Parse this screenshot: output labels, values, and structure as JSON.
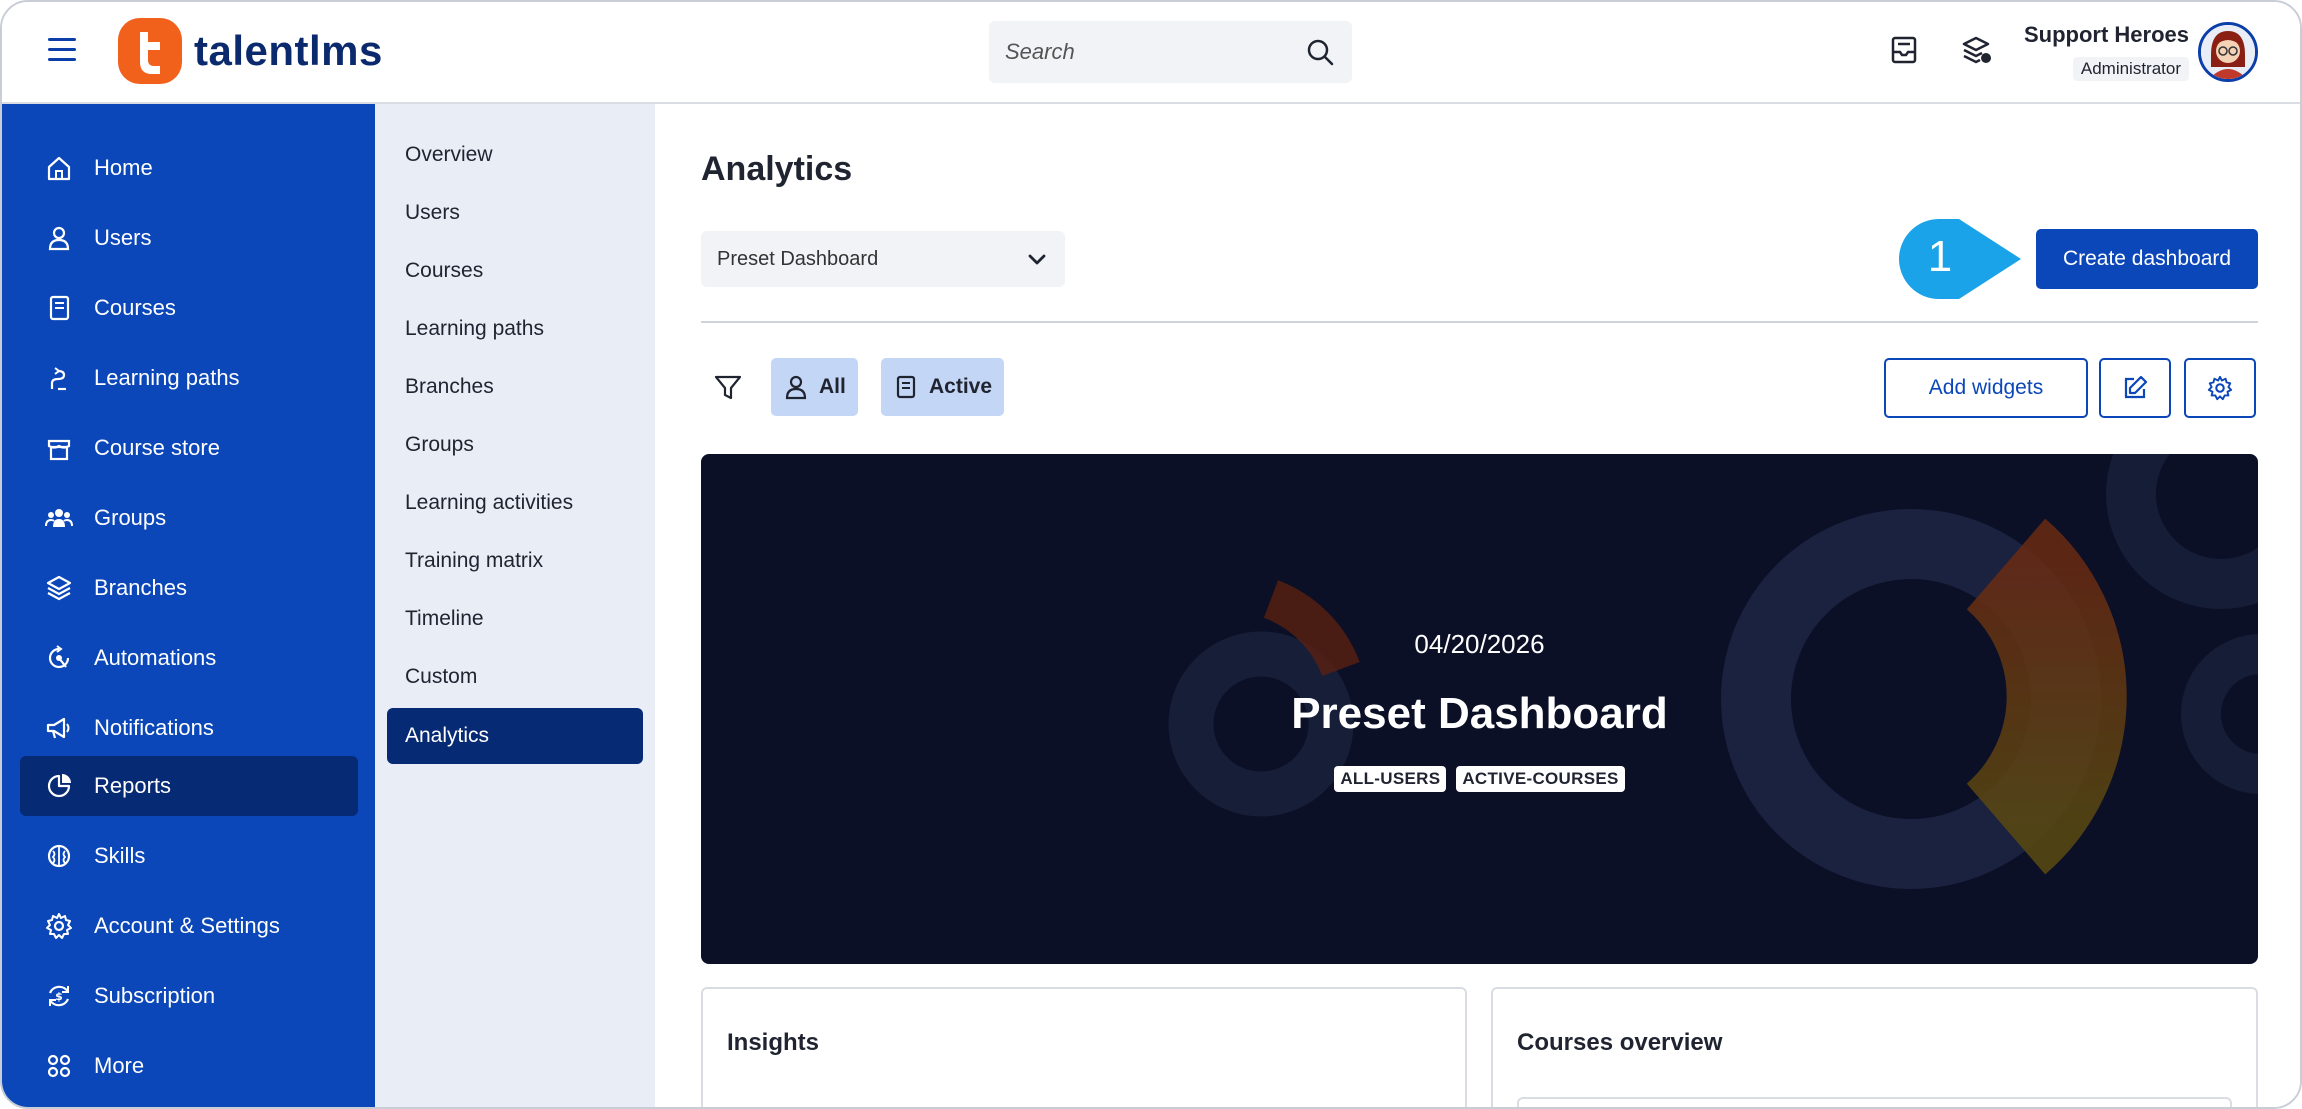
{
  "brand": {
    "name": "talentlms",
    "logo_color": "#f2611c",
    "text_color": "#0b2a6e"
  },
  "topbar": {
    "search_placeholder": "Search",
    "icons": [
      "inbox-icon",
      "messages-icon"
    ],
    "user": {
      "name": "Support Heroes",
      "role": "Administrator"
    }
  },
  "sidebar": {
    "color": "#0b47b8",
    "active_color": "#072a75",
    "items": [
      {
        "label": "Home",
        "icon": "home-icon"
      },
      {
        "label": "Users",
        "icon": "user-icon"
      },
      {
        "label": "Courses",
        "icon": "book-icon"
      },
      {
        "label": "Learning paths",
        "icon": "path-icon"
      },
      {
        "label": "Course store",
        "icon": "store-icon"
      },
      {
        "label": "Groups",
        "icon": "groups-icon"
      },
      {
        "label": "Branches",
        "icon": "layers-icon"
      },
      {
        "label": "Automations",
        "icon": "automation-icon"
      },
      {
        "label": "Notifications",
        "icon": "megaphone-icon"
      },
      {
        "label": "Reports",
        "icon": "pie-chart-icon",
        "active": true
      },
      {
        "label": "Skills",
        "icon": "brain-icon"
      },
      {
        "label": "Account & Settings",
        "icon": "gear-icon"
      },
      {
        "label": "Subscription",
        "icon": "subscription-icon"
      },
      {
        "label": "More",
        "icon": "grid-icon"
      }
    ]
  },
  "subnav": {
    "items": [
      {
        "label": "Overview"
      },
      {
        "label": "Users"
      },
      {
        "label": "Courses"
      },
      {
        "label": "Learning paths"
      },
      {
        "label": "Branches"
      },
      {
        "label": "Groups"
      },
      {
        "label": "Learning activities"
      },
      {
        "label": "Training matrix"
      },
      {
        "label": "Timeline"
      },
      {
        "label": "Custom"
      },
      {
        "label": "Analytics",
        "active": true
      }
    ]
  },
  "main": {
    "title": "Analytics",
    "dashboard_select": {
      "selected": "Preset Dashboard"
    },
    "callout_number": "1",
    "callout_color": "#1aa3e8",
    "create_button": "Create dashboard",
    "filters": {
      "users_chip": "All",
      "courses_chip": "Active"
    },
    "add_widgets_button": "Add widgets",
    "banner": {
      "date": "04/20/2026",
      "title": "Preset Dashboard",
      "tags": [
        "ALL-USERS",
        "ACTIVE-COURSES"
      ]
    },
    "cards": [
      {
        "title": "Insights"
      },
      {
        "title": "Courses overview"
      }
    ]
  }
}
